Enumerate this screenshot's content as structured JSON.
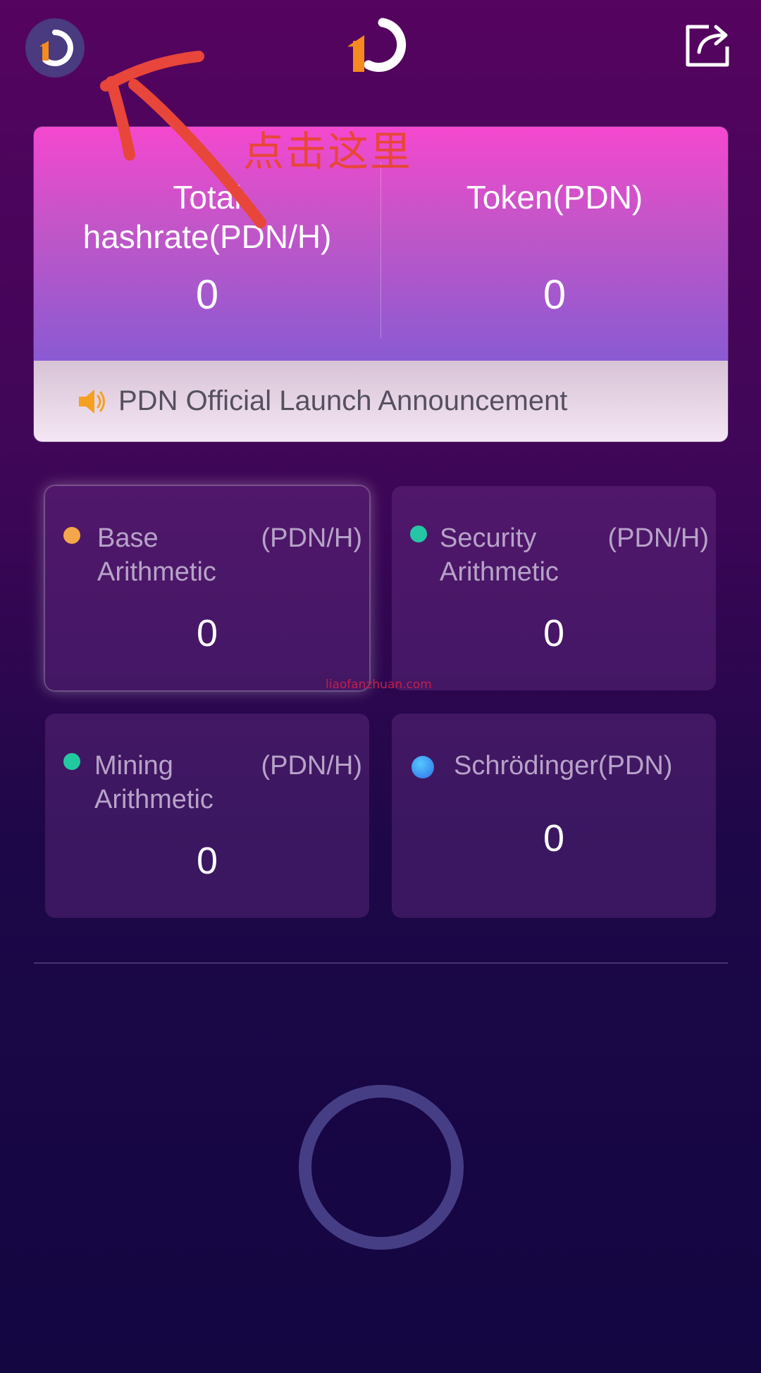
{
  "header": {
    "avatar_icon": "pdn-logo-icon",
    "logo_icon": "pdn-logo-icon",
    "share_icon": "share-icon"
  },
  "summary": {
    "total_hashrate_label": "Total hashrate(PDN/H)",
    "total_hashrate_value": "0",
    "token_label": "Token(PDN)",
    "token_value": "0"
  },
  "announcement": {
    "icon": "speaker-icon",
    "text": "PDN Official Launch Announcement"
  },
  "cards": [
    {
      "title": "Base Arithmetic",
      "unit": "(PDN/H)",
      "value": "0",
      "dot_color": "#f5a64a"
    },
    {
      "title": "Security Arithmetic",
      "unit": "(PDN/H)",
      "value": "0",
      "dot_color": "#25c6a5"
    },
    {
      "title": "Mining Arithmetic",
      "unit": "(PDN/H)",
      "value": "0",
      "dot_color": "#22c9a0"
    },
    {
      "title": "Schrödinger(PDN)",
      "unit": "",
      "value": "0",
      "dot_color": "#2f8ff0"
    }
  ],
  "annotation": {
    "text": "点击这里"
  },
  "watermark": "liaofanzhuan.com",
  "colors": {
    "accent_orange": "#f58b1f",
    "annotation_red": "#e8463a",
    "ring": "#463e85"
  }
}
